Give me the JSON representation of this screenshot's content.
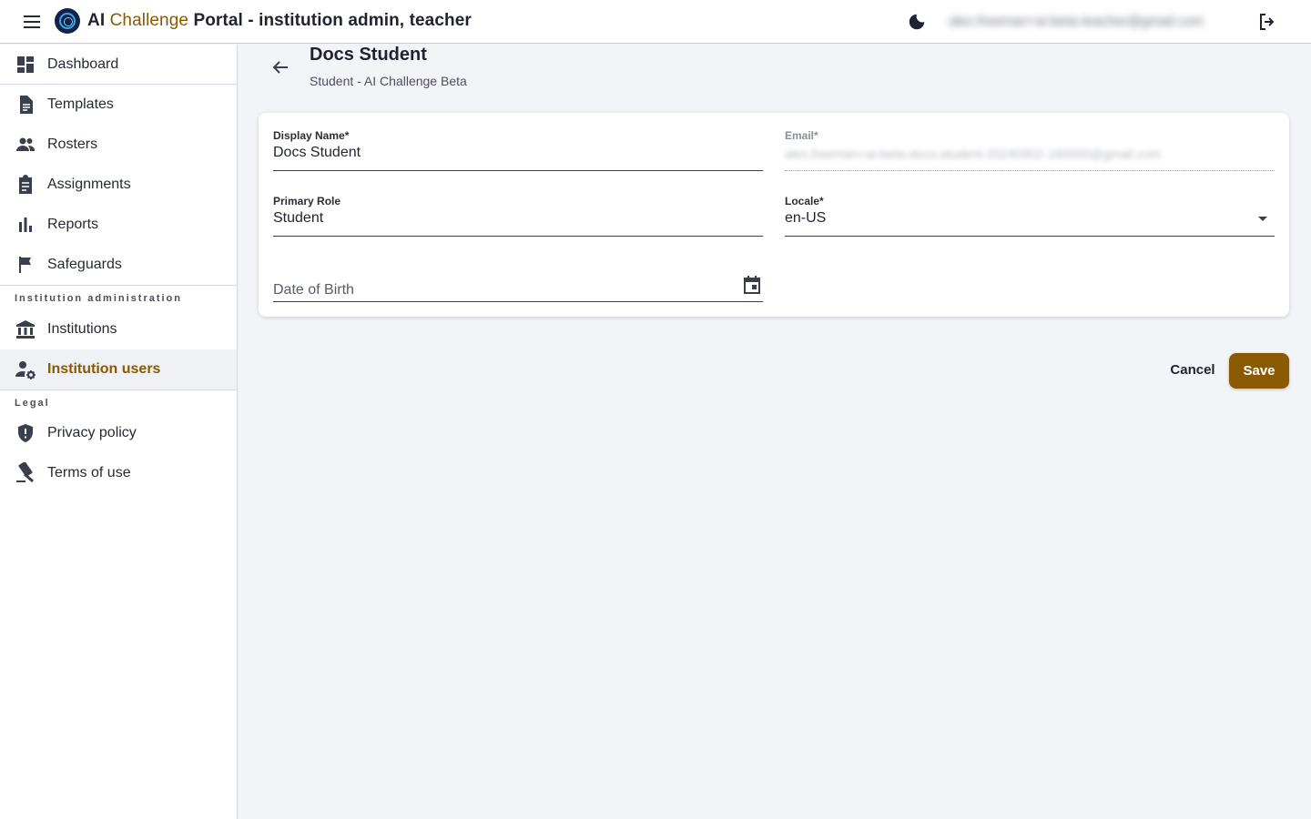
{
  "header": {
    "title_part1": "AI ",
    "title_part2": "Challenge",
    "title_part3": " Portal - institution admin, teacher",
    "user_email": "alex.freeman+ai-beta-teacher@gmail.com",
    "icons": {
      "menu": "menu-icon",
      "logo": "logo-icon",
      "theme": "moon-icon",
      "logout": "logout-icon"
    }
  },
  "sidebar": {
    "items": [
      {
        "label": "Dashboard",
        "icon": "dashboard-icon"
      },
      {
        "label": "Templates",
        "icon": "document-icon"
      },
      {
        "label": "Rosters",
        "icon": "people-icon"
      },
      {
        "label": "Assignments",
        "icon": "clipboard-icon"
      },
      {
        "label": "Reports",
        "icon": "bar-chart-icon"
      },
      {
        "label": "Safeguards",
        "icon": "flag-icon"
      }
    ],
    "section_admin": "Institution administration",
    "admin_items": [
      {
        "label": "Institutions",
        "icon": "institution-icon"
      },
      {
        "label": "Institution users",
        "icon": "user-settings-icon",
        "active": true
      }
    ],
    "section_legal": "Legal",
    "legal_items": [
      {
        "label": "Privacy policy",
        "icon": "shield-icon"
      },
      {
        "label": "Terms of use",
        "icon": "gavel-icon"
      }
    ],
    "accent_color": "#8a5a00"
  },
  "page": {
    "title": "Docs Student",
    "subtitle": "Student - AI Challenge Beta"
  },
  "form": {
    "display_name": {
      "label": "Display Name*",
      "value": "Docs Student"
    },
    "email": {
      "label": "Email*",
      "value": "alex.freeman+ai-beta-docs-student-20240902-180000@gmail.com"
    },
    "primary_role": {
      "label": "Primary Role",
      "value": "Student"
    },
    "locale": {
      "label": "Locale*",
      "value": "en-US"
    },
    "date_of_birth": {
      "placeholder": "Date of Birth"
    }
  },
  "actions": {
    "cancel": "Cancel",
    "save": "Save"
  }
}
